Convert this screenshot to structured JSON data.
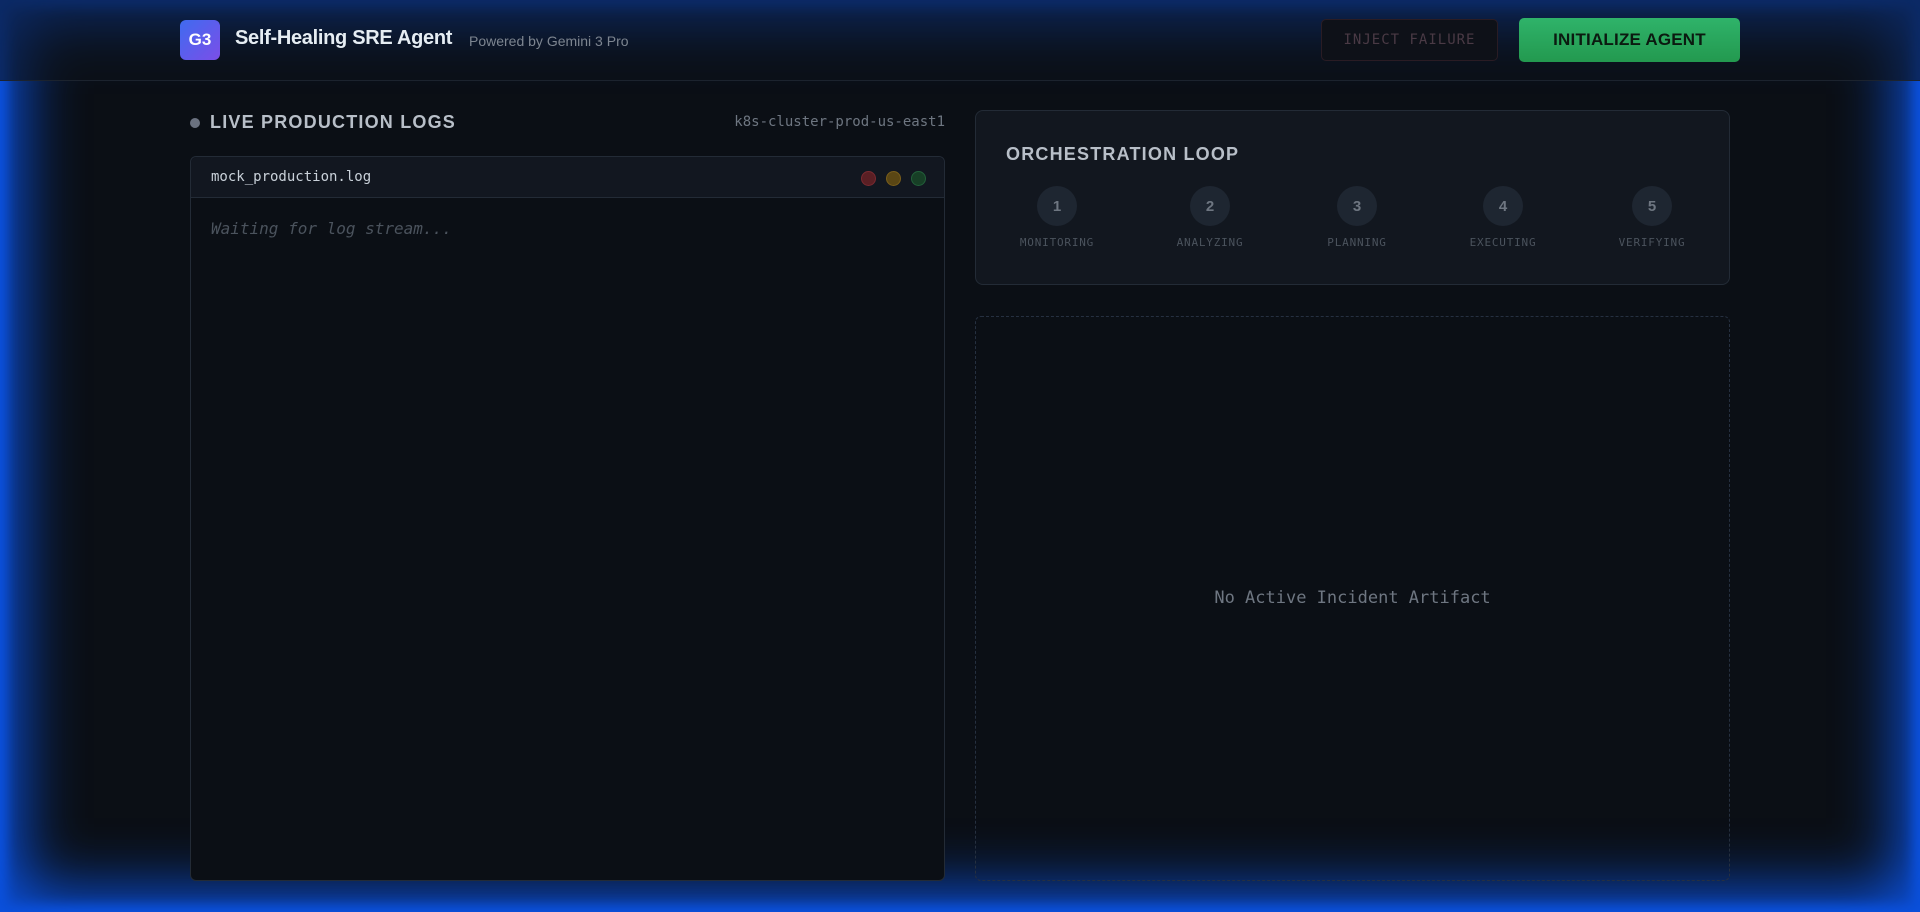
{
  "header": {
    "logo_text": "G3",
    "title": "Self-Healing SRE Agent",
    "subtitle": "Powered by Gemini 3 Pro",
    "inject_failure_label": "INJECT FAILURE",
    "initialize_agent_label": "INITIALIZE AGENT"
  },
  "logs": {
    "section_title": "LIVE PRODUCTION LOGS",
    "cluster": "k8s-cluster-prod-us-east1",
    "filename": "mock_production.log",
    "placeholder": "Waiting for log stream..."
  },
  "orchestration": {
    "title": "ORCHESTRATION LOOP",
    "steps": [
      {
        "number": "1",
        "label": "MONITORING"
      },
      {
        "number": "2",
        "label": "ANALYZING"
      },
      {
        "number": "3",
        "label": "PLANNING"
      },
      {
        "number": "4",
        "label": "EXECUTING"
      },
      {
        "number": "5",
        "label": "VERIFYING"
      }
    ]
  },
  "artifact": {
    "empty_text": "No Active Incident Artifact"
  },
  "colors": {
    "accent_green": "#2fb36a",
    "glow_blue": "#0a5cff",
    "background": "#0b0f15"
  }
}
